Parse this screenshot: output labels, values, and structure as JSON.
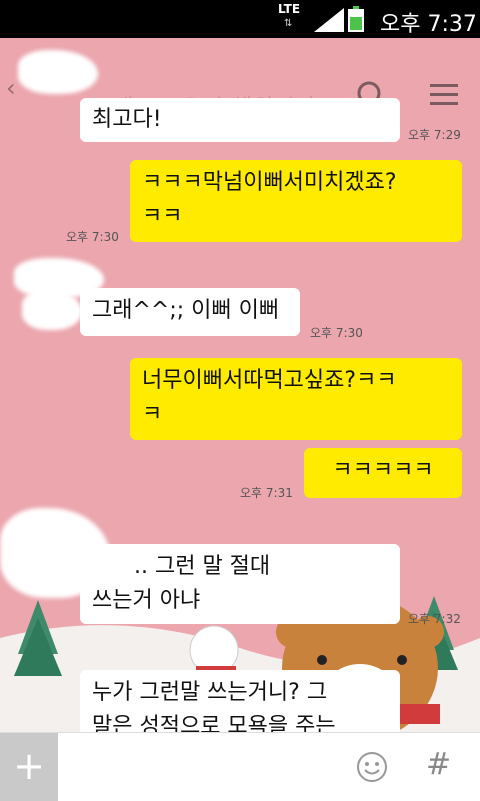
{
  "status_bar": {
    "network": "LTE",
    "time": "오후 7:37"
  },
  "header": {
    "back_icon": "chevron-left-icon",
    "ghost_text": "그래^^ 우리 채원이가",
    "search_icon": "search-icon",
    "menu_icon": "hamburger-menu-icon"
  },
  "messages": [
    {
      "from": "other",
      "text": "최고다!",
      "time": "오후 7:29"
    },
    {
      "from": "me",
      "line1": "ㅋㅋㅋ막넘이뻐서미치겠죠?",
      "line2": "ㅋㅋ",
      "time": "오후 7:30"
    },
    {
      "from": "other",
      "text": "그래^^;; 이뻐 이뻐",
      "time": "오후 7:30"
    },
    {
      "from": "me",
      "line1": "너무이뻐서따먹고싶죠?ㅋㅋ",
      "line2": "ㅋ"
    },
    {
      "from": "me",
      "text": "ㅋㅋㅋㅋㅋ",
      "time": "오후 7:31"
    },
    {
      "from": "other",
      "line1": ".. 그런 말 절대",
      "line2": "쓰는거 아냐",
      "time": "오후 7:32"
    },
    {
      "from": "other",
      "line1": "누가 그런말 쓰는거니? 그",
      "line2": "말은 성적으로 모욕을 주는"
    }
  ],
  "bottom_bar": {
    "plus_label": "+",
    "emoji_icon": "emoticon-icon",
    "hash_label": "#"
  },
  "colors": {
    "chat_bg": "#eba6ae",
    "my_bubble": "#ffeb00",
    "other_bubble": "#ffffff"
  }
}
